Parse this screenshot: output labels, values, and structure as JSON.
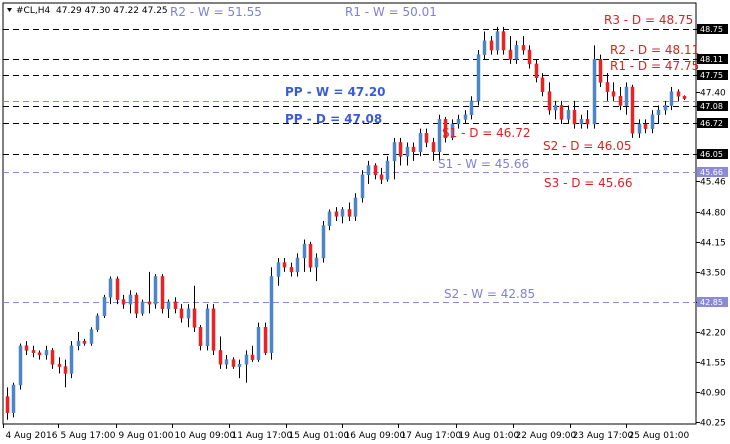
{
  "header": {
    "symbol": "#CL,H4",
    "quote": "47.29 47.30 47.22 47.25"
  },
  "colors": {
    "bull": "#4a86c8",
    "bear": "#ee2020",
    "weekly": "#8a8ad8",
    "daily": "#000000",
    "axis_tag_weekly": "#8a8ad8",
    "axis_tag_dark": "#000000"
  },
  "chart_data": {
    "type": "candlestick",
    "ylim": [
      40.25,
      48.95
    ],
    "y_ticks": [
      "48.75",
      "48.11",
      "47.75",
      "47.40",
      "47.08",
      "46.72",
      "46.05",
      "45.46",
      "44.80",
      "44.15",
      "43.50",
      "42.85",
      "42.20",
      "41.55",
      "40.90",
      "40.25"
    ],
    "x_ticks": [
      "4 Aug 2016",
      "5 Aug 17:00",
      "9 Aug 01:00",
      "10 Aug 09:00",
      "11 Aug 17:00",
      "15 Aug 01:00",
      "16 Aug 09:00",
      "17 Aug 17:00",
      "19 Aug 01:00",
      "22 Aug 09:00",
      "23 Aug 17:00",
      "25 Aug 01:00"
    ],
    "levels": [
      {
        "label": "R2 - W = 51.55",
        "style": "weekly-label-only"
      },
      {
        "label": "R1 - W = 50.01",
        "style": "weekly-label-only"
      },
      {
        "label": "R3 - D = 48.75",
        "value": 48.75,
        "style": "daily"
      },
      {
        "label": "R2 - D = 48.11",
        "value": 48.11,
        "style": "daily"
      },
      {
        "label": "R1 - D = 47.75",
        "value": 47.75,
        "style": "daily"
      },
      {
        "label": "PP - W = 47.20",
        "value": 47.2,
        "style": "weekly-pp"
      },
      {
        "label": "PP - D = 47.08",
        "value": 47.08,
        "style": "daily-pp"
      },
      {
        "label": "S1 - D = 46.72",
        "value": 46.72,
        "style": "daily"
      },
      {
        "label": "S2 - D = 46.05",
        "value": 46.05,
        "style": "daily"
      },
      {
        "label": "S1 - W = 45.66",
        "value": 45.66,
        "style": "weekly"
      },
      {
        "label": "S3 - D = 45.66",
        "value": 45.66,
        "style": "daily-label-only"
      },
      {
        "label": "S2 - W = 42.85",
        "value": 42.85,
        "style": "weekly"
      }
    ],
    "axis_tags": [
      {
        "text": "48.75",
        "value": 48.75,
        "style": "dark"
      },
      {
        "text": "48.11",
        "value": 48.11,
        "style": "dark"
      },
      {
        "text": "47.75",
        "value": 47.75,
        "style": "dark"
      },
      {
        "text": "47.08",
        "value": 47.08,
        "style": "dark"
      },
      {
        "text": "46.72",
        "value": 46.72,
        "style": "dark"
      },
      {
        "text": "46.05",
        "value": 46.05,
        "style": "dark"
      },
      {
        "text": "45.66",
        "value": 45.66,
        "style": "weekly"
      },
      {
        "text": "42.85",
        "value": 42.85,
        "style": "weekly"
      }
    ],
    "candles": [
      {
        "o": 40.8,
        "h": 41.0,
        "l": 40.3,
        "c": 40.45
      },
      {
        "o": 40.45,
        "h": 41.1,
        "l": 40.35,
        "c": 41.05
      },
      {
        "o": 41.05,
        "h": 41.95,
        "l": 40.95,
        "c": 41.9
      },
      {
        "o": 41.9,
        "h": 42.0,
        "l": 41.7,
        "c": 41.8
      },
      {
        "o": 41.8,
        "h": 41.9,
        "l": 41.65,
        "c": 41.75
      },
      {
        "o": 41.75,
        "h": 41.8,
        "l": 41.6,
        "c": 41.7
      },
      {
        "o": 41.7,
        "h": 41.9,
        "l": 41.6,
        "c": 41.8
      },
      {
        "o": 41.8,
        "h": 41.85,
        "l": 41.4,
        "c": 41.5
      },
      {
        "o": 41.5,
        "h": 41.65,
        "l": 41.3,
        "c": 41.45
      },
      {
        "o": 41.45,
        "h": 41.6,
        "l": 41.0,
        "c": 41.3
      },
      {
        "o": 41.3,
        "h": 42.0,
        "l": 41.2,
        "c": 41.9
      },
      {
        "o": 41.9,
        "h": 42.2,
        "l": 41.8,
        "c": 42.0
      },
      {
        "o": 42.0,
        "h": 42.05,
        "l": 41.9,
        "c": 41.95
      },
      {
        "o": 41.95,
        "h": 42.3,
        "l": 41.9,
        "c": 42.25
      },
      {
        "o": 42.25,
        "h": 42.6,
        "l": 42.2,
        "c": 42.55
      },
      {
        "o": 42.55,
        "h": 43.0,
        "l": 42.5,
        "c": 42.95
      },
      {
        "o": 42.95,
        "h": 43.4,
        "l": 42.8,
        "c": 43.35
      },
      {
        "o": 43.35,
        "h": 43.4,
        "l": 42.8,
        "c": 42.9
      },
      {
        "o": 42.9,
        "h": 43.0,
        "l": 42.7,
        "c": 42.8
      },
      {
        "o": 42.8,
        "h": 43.1,
        "l": 42.6,
        "c": 43.0
      },
      {
        "o": 43.0,
        "h": 43.05,
        "l": 42.5,
        "c": 42.6
      },
      {
        "o": 42.6,
        "h": 42.9,
        "l": 42.55,
        "c": 42.85
      },
      {
        "o": 42.85,
        "h": 43.5,
        "l": 42.6,
        "c": 42.8
      },
      {
        "o": 42.8,
        "h": 43.45,
        "l": 42.7,
        "c": 43.4
      },
      {
        "o": 43.4,
        "h": 43.45,
        "l": 42.6,
        "c": 42.7
      },
      {
        "o": 42.7,
        "h": 42.9,
        "l": 42.5,
        "c": 42.85
      },
      {
        "o": 42.85,
        "h": 42.95,
        "l": 42.6,
        "c": 42.7
      },
      {
        "o": 42.7,
        "h": 42.8,
        "l": 42.4,
        "c": 42.5
      },
      {
        "o": 42.5,
        "h": 42.8,
        "l": 42.3,
        "c": 42.7
      },
      {
        "o": 42.7,
        "h": 43.2,
        "l": 42.2,
        "c": 42.3
      },
      {
        "o": 42.3,
        "h": 42.35,
        "l": 41.8,
        "c": 41.9
      },
      {
        "o": 41.9,
        "h": 42.8,
        "l": 41.8,
        "c": 42.7
      },
      {
        "o": 42.7,
        "h": 42.8,
        "l": 41.7,
        "c": 41.8
      },
      {
        "o": 41.8,
        "h": 42.1,
        "l": 41.4,
        "c": 41.5
      },
      {
        "o": 41.5,
        "h": 41.7,
        "l": 41.4,
        "c": 41.6
      },
      {
        "o": 41.6,
        "h": 41.65,
        "l": 41.4,
        "c": 41.45
      },
      {
        "o": 41.45,
        "h": 41.6,
        "l": 41.2,
        "c": 41.5
      },
      {
        "o": 41.5,
        "h": 41.8,
        "l": 41.1,
        "c": 41.7
      },
      {
        "o": 41.7,
        "h": 41.9,
        "l": 41.55,
        "c": 41.6
      },
      {
        "o": 41.6,
        "h": 42.4,
        "l": 41.55,
        "c": 42.3
      },
      {
        "o": 42.3,
        "h": 42.4,
        "l": 41.7,
        "c": 41.75
      },
      {
        "o": 41.75,
        "h": 43.6,
        "l": 41.6,
        "c": 43.4
      },
      {
        "o": 43.4,
        "h": 43.8,
        "l": 43.2,
        "c": 43.7
      },
      {
        "o": 43.7,
        "h": 43.8,
        "l": 43.5,
        "c": 43.6
      },
      {
        "o": 43.6,
        "h": 43.7,
        "l": 43.4,
        "c": 43.5
      },
      {
        "o": 43.5,
        "h": 43.9,
        "l": 43.4,
        "c": 43.8
      },
      {
        "o": 43.8,
        "h": 44.2,
        "l": 43.5,
        "c": 44.1
      },
      {
        "o": 44.1,
        "h": 44.15,
        "l": 43.5,
        "c": 43.6
      },
      {
        "o": 43.6,
        "h": 43.9,
        "l": 43.3,
        "c": 43.8
      },
      {
        "o": 43.8,
        "h": 44.6,
        "l": 43.7,
        "c": 44.5
      },
      {
        "o": 44.5,
        "h": 44.85,
        "l": 44.4,
        "c": 44.8
      },
      {
        "o": 44.8,
        "h": 44.9,
        "l": 44.6,
        "c": 44.7
      },
      {
        "o": 44.7,
        "h": 44.9,
        "l": 44.55,
        "c": 44.85
      },
      {
        "o": 44.85,
        "h": 45.0,
        "l": 44.6,
        "c": 44.7
      },
      {
        "o": 44.7,
        "h": 45.2,
        "l": 44.6,
        "c": 45.1
      },
      {
        "o": 45.1,
        "h": 45.7,
        "l": 45.0,
        "c": 45.6
      },
      {
        "o": 45.6,
        "h": 45.9,
        "l": 45.4,
        "c": 45.8
      },
      {
        "o": 45.8,
        "h": 45.85,
        "l": 45.5,
        "c": 45.6
      },
      {
        "o": 45.6,
        "h": 45.75,
        "l": 45.4,
        "c": 45.5
      },
      {
        "o": 45.5,
        "h": 46.0,
        "l": 45.45,
        "c": 45.9
      },
      {
        "o": 45.9,
        "h": 46.4,
        "l": 45.5,
        "c": 46.3
      },
      {
        "o": 46.3,
        "h": 46.4,
        "l": 45.8,
        "c": 46.0
      },
      {
        "o": 46.0,
        "h": 46.3,
        "l": 45.8,
        "c": 46.2
      },
      {
        "o": 46.2,
        "h": 46.3,
        "l": 45.9,
        "c": 46.1
      },
      {
        "o": 46.1,
        "h": 46.6,
        "l": 46.0,
        "c": 46.5
      },
      {
        "o": 46.5,
        "h": 46.6,
        "l": 46.2,
        "c": 46.3
      },
      {
        "o": 46.3,
        "h": 46.4,
        "l": 45.9,
        "c": 46.1
      },
      {
        "o": 46.1,
        "h": 46.9,
        "l": 45.9,
        "c": 46.8
      },
      {
        "o": 46.8,
        "h": 46.85,
        "l": 46.3,
        "c": 46.4
      },
      {
        "o": 46.4,
        "h": 46.8,
        "l": 46.35,
        "c": 46.7
      },
      {
        "o": 46.7,
        "h": 46.9,
        "l": 46.6,
        "c": 46.8
      },
      {
        "o": 46.8,
        "h": 47.0,
        "l": 46.7,
        "c": 46.9
      },
      {
        "o": 46.9,
        "h": 47.3,
        "l": 46.8,
        "c": 47.2
      },
      {
        "o": 47.2,
        "h": 48.3,
        "l": 47.1,
        "c": 48.2
      },
      {
        "o": 48.2,
        "h": 48.7,
        "l": 48.1,
        "c": 48.5
      },
      {
        "o": 48.5,
        "h": 48.6,
        "l": 48.2,
        "c": 48.3
      },
      {
        "o": 48.3,
        "h": 48.8,
        "l": 48.2,
        "c": 48.7
      },
      {
        "o": 48.7,
        "h": 48.8,
        "l": 48.2,
        "c": 48.3
      },
      {
        "o": 48.3,
        "h": 48.6,
        "l": 48.0,
        "c": 48.1
      },
      {
        "o": 48.1,
        "h": 48.5,
        "l": 48.0,
        "c": 48.4
      },
      {
        "o": 48.4,
        "h": 48.6,
        "l": 48.2,
        "c": 48.3
      },
      {
        "o": 48.3,
        "h": 48.4,
        "l": 47.9,
        "c": 48.0
      },
      {
        "o": 48.0,
        "h": 48.1,
        "l": 47.6,
        "c": 47.7
      },
      {
        "o": 47.7,
        "h": 47.8,
        "l": 47.3,
        "c": 47.4
      },
      {
        "o": 47.4,
        "h": 47.6,
        "l": 46.9,
        "c": 47.0
      },
      {
        "o": 47.0,
        "h": 47.2,
        "l": 46.8,
        "c": 47.1
      },
      {
        "o": 47.1,
        "h": 47.2,
        "l": 46.7,
        "c": 46.8
      },
      {
        "o": 46.8,
        "h": 47.1,
        "l": 46.7,
        "c": 47.0
      },
      {
        "o": 47.0,
        "h": 47.2,
        "l": 46.6,
        "c": 46.7
      },
      {
        "o": 46.7,
        "h": 46.9,
        "l": 46.6,
        "c": 46.8
      },
      {
        "o": 46.8,
        "h": 47.0,
        "l": 46.6,
        "c": 46.7
      },
      {
        "o": 46.7,
        "h": 48.4,
        "l": 46.6,
        "c": 48.1
      },
      {
        "o": 48.1,
        "h": 48.2,
        "l": 47.5,
        "c": 47.6
      },
      {
        "o": 47.6,
        "h": 47.8,
        "l": 47.2,
        "c": 47.4
      },
      {
        "o": 47.4,
        "h": 47.6,
        "l": 47.2,
        "c": 47.3
      },
      {
        "o": 47.3,
        "h": 47.5,
        "l": 47.0,
        "c": 47.1
      },
      {
        "o": 47.1,
        "h": 47.6,
        "l": 46.9,
        "c": 47.5
      },
      {
        "o": 47.5,
        "h": 47.55,
        "l": 46.4,
        "c": 46.5
      },
      {
        "o": 46.5,
        "h": 46.8,
        "l": 46.4,
        "c": 46.7
      },
      {
        "o": 46.7,
        "h": 46.8,
        "l": 46.5,
        "c": 46.6
      },
      {
        "o": 46.6,
        "h": 47.0,
        "l": 46.5,
        "c": 46.9
      },
      {
        "o": 46.9,
        "h": 47.1,
        "l": 46.7,
        "c": 47.0
      },
      {
        "o": 47.0,
        "h": 47.2,
        "l": 46.9,
        "c": 47.1
      },
      {
        "o": 47.1,
        "h": 47.5,
        "l": 47.0,
        "c": 47.4
      },
      {
        "o": 47.4,
        "h": 47.45,
        "l": 47.2,
        "c": 47.3
      },
      {
        "o": 47.3,
        "h": 47.32,
        "l": 47.22,
        "c": 47.25
      }
    ]
  }
}
